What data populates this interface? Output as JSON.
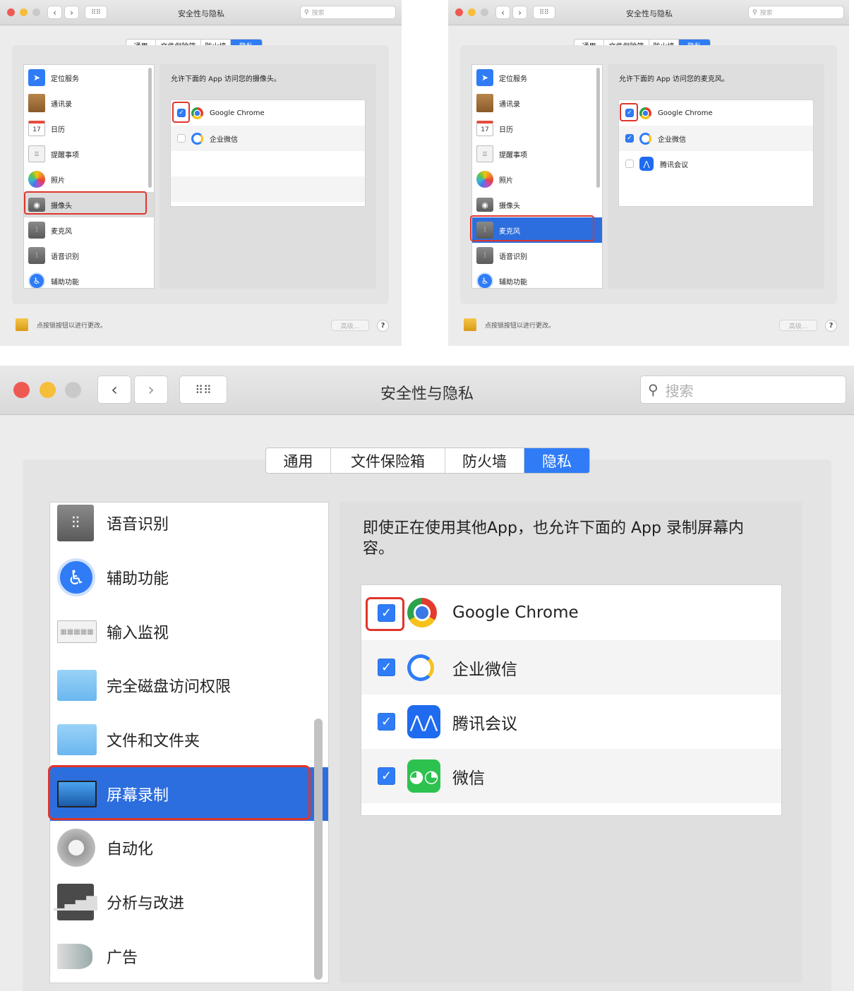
{
  "window": {
    "title": "安全性与隐私",
    "search_placeholder": "搜索"
  },
  "tabs": [
    {
      "label": "通用"
    },
    {
      "label": "文件保险箱"
    },
    {
      "label": "防火墙"
    },
    {
      "label": "隐私"
    }
  ],
  "selected_tab": "隐私",
  "colors": {
    "accent": "#2f7cf6",
    "selection": "#2d6ede",
    "highlight_box": "#e0352b"
  },
  "panel_camera": {
    "sidebar": [
      {
        "label": "定位服务",
        "icon": "location-icon"
      },
      {
        "label": "通讯录",
        "icon": "contacts-icon"
      },
      {
        "label": "日历",
        "icon": "calendar-icon"
      },
      {
        "label": "提醒事项",
        "icon": "reminders-icon"
      },
      {
        "label": "照片",
        "icon": "photos-icon"
      },
      {
        "label": "摄像头",
        "icon": "camera-icon"
      },
      {
        "label": "麦克风",
        "icon": "microphone-icon"
      },
      {
        "label": "语音识别",
        "icon": "speech-icon"
      },
      {
        "label": "辅助功能",
        "icon": "accessibility-icon"
      }
    ],
    "selected_item": "摄像头",
    "description": "允许下面的 App 访问您的摄像头。",
    "apps": [
      {
        "name": "Google Chrome",
        "checked": true,
        "icon": "chrome-icon"
      },
      {
        "name": "企业微信",
        "checked": false,
        "icon": "wecom-icon"
      }
    ],
    "footer_text": "点按锁按钮以进行更改。",
    "advanced_label": "高级...",
    "help_label": "?"
  },
  "panel_microphone": {
    "sidebar": [
      {
        "label": "定位服务",
        "icon": "location-icon"
      },
      {
        "label": "通讯录",
        "icon": "contacts-icon"
      },
      {
        "label": "日历",
        "icon": "calendar-icon"
      },
      {
        "label": "提醒事项",
        "icon": "reminders-icon"
      },
      {
        "label": "照片",
        "icon": "photos-icon"
      },
      {
        "label": "摄像头",
        "icon": "camera-icon"
      },
      {
        "label": "麦克风",
        "icon": "microphone-icon"
      },
      {
        "label": "语音识别",
        "icon": "speech-icon"
      },
      {
        "label": "辅助功能",
        "icon": "accessibility-icon"
      }
    ],
    "selected_item": "麦克风",
    "description": "允许下面的 App 访问您的麦克风。",
    "apps": [
      {
        "name": "Google Chrome",
        "checked": true,
        "icon": "chrome-icon"
      },
      {
        "name": "企业微信",
        "checked": true,
        "icon": "wecom-icon"
      },
      {
        "name": "腾讯会议",
        "checked": false,
        "icon": "tencent-meeting-icon"
      }
    ],
    "footer_text": "点按锁按钮以进行更改。",
    "advanced_label": "高级...",
    "help_label": "?"
  },
  "panel_screen": {
    "sidebar": [
      {
        "label": "语音识别",
        "icon": "speech-icon"
      },
      {
        "label": "辅助功能",
        "icon": "accessibility-icon"
      },
      {
        "label": "输入监视",
        "icon": "keyboard-icon"
      },
      {
        "label": "完全磁盘访问权限",
        "icon": "folder-icon"
      },
      {
        "label": "文件和文件夹",
        "icon": "folder-icon"
      },
      {
        "label": "屏幕录制",
        "icon": "monitor-icon"
      },
      {
        "label": "自动化",
        "icon": "gear-icon"
      },
      {
        "label": "分析与改进",
        "icon": "analytics-icon"
      },
      {
        "label": "广告",
        "icon": "megaphone-icon"
      }
    ],
    "selected_item": "屏幕录制",
    "description": "即使正在使用其他App，也允许下面的 App 录制屏幕内容。",
    "apps": [
      {
        "name": "Google Chrome",
        "checked": true,
        "icon": "chrome-icon"
      },
      {
        "name": "企业微信",
        "checked": true,
        "icon": "wecom-icon"
      },
      {
        "name": "腾讯会议",
        "checked": true,
        "icon": "tencent-meeting-icon"
      },
      {
        "name": "微信",
        "checked": true,
        "icon": "wechat-icon"
      }
    ]
  }
}
